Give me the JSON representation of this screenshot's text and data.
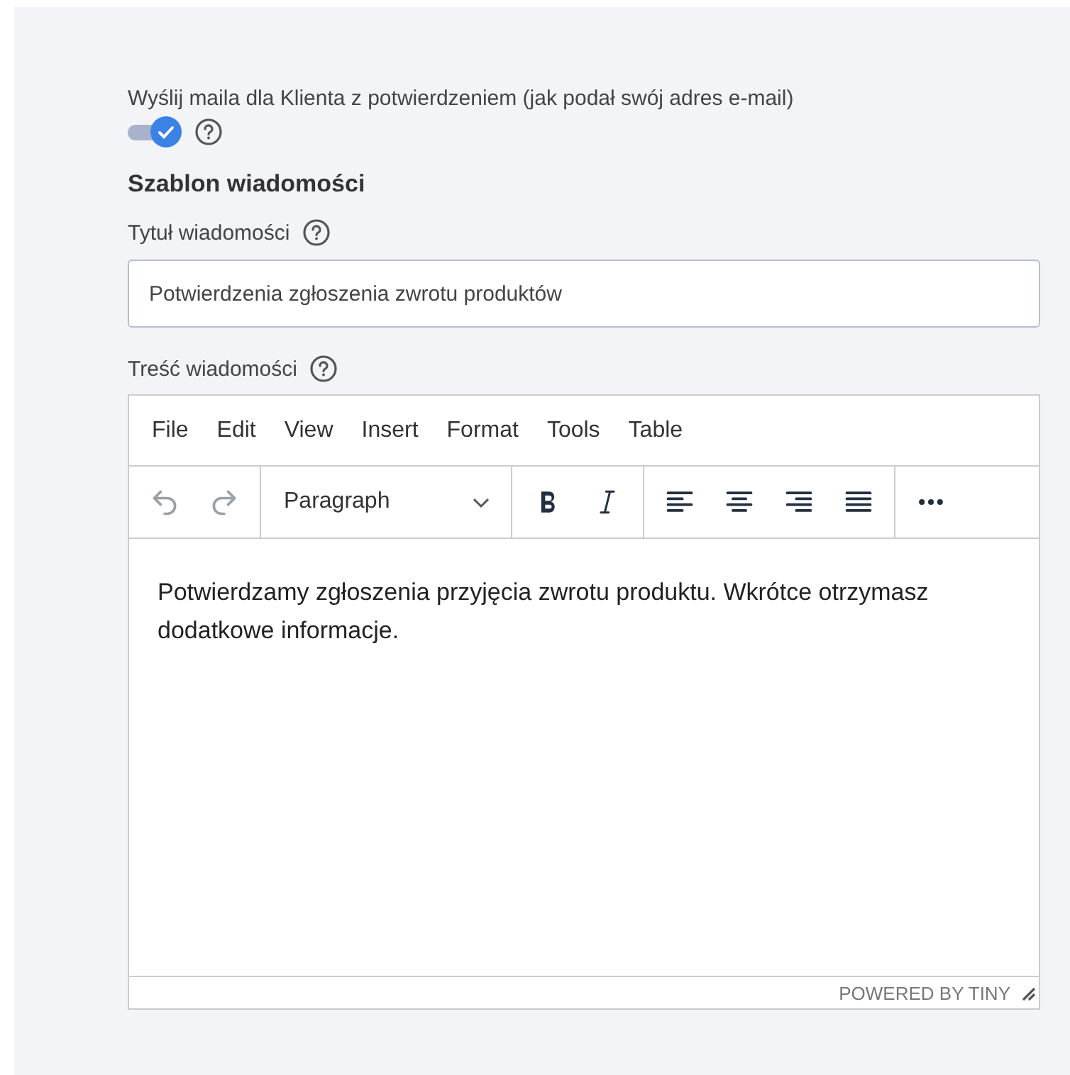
{
  "send_email": {
    "label": "Wyślij maila dla Klienta z potwierdzeniem (jak podał swój adres e-mail)",
    "on": true
  },
  "template_heading": "Szablon wiadomości",
  "title_field": {
    "label": "Tytuł wiadomości",
    "value": "Potwierdzenia zgłoszenia zwrotu produktów"
  },
  "body_field": {
    "label": "Treść wiadomości"
  },
  "editor": {
    "menu": [
      "File",
      "Edit",
      "View",
      "Insert",
      "Format",
      "Tools",
      "Table"
    ],
    "undo_disabled": true,
    "redo_disabled": true,
    "block_format": "Paragraph",
    "content": "Potwierdzamy zgłoszenia przyjęcia zwrotu produktu. Wkrótce otrzymasz dodatkowe informacje.",
    "branding": "POWERED BY TINY"
  }
}
